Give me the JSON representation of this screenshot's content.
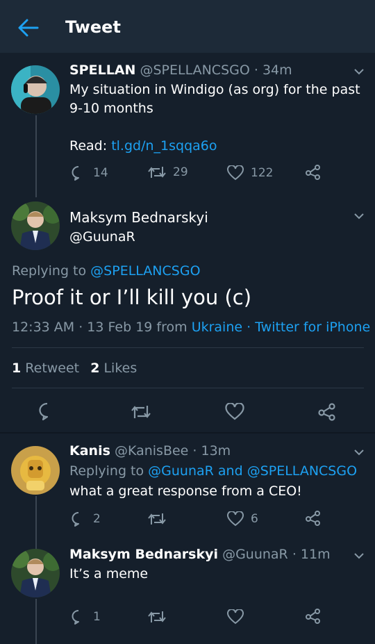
{
  "header": {
    "title": "Tweet"
  },
  "tweet1": {
    "name": "SPELLAN",
    "handle": "@SPELLANCSGO",
    "time": "· 34m",
    "text_line1": "My situation in Windigo (as org) for the past",
    "text_line2": "9-10 months",
    "read_label": "Read:",
    "link": "tl.gd/n_1sqqa6o",
    "replies": "14",
    "retweets": "29",
    "likes": "122"
  },
  "main": {
    "name": "Maksym Bednarskyi",
    "handle": "@GuunaR",
    "replying_label": "Replying to",
    "replying_to": "@SPELLANCSGO",
    "text": "Proof it or I’ll kill you (c)",
    "time": "12:33 AM · 13 Feb 19 from",
    "location": "Ukraine",
    "source": "· Twitter for iPhone",
    "retweet_count": "1",
    "retweet_label": "Retweet",
    "like_count": "2",
    "like_label": "Likes"
  },
  "reply1": {
    "name": "Kanis",
    "handle": "@KanisBee",
    "time": "· 13m",
    "replying_label": "Replying to",
    "replying_to": "@GuunaR and @SPELLANCSGO",
    "text": "what a great response from a CEO!",
    "replies": "2",
    "likes": "6"
  },
  "reply2": {
    "name": "Maksym Bednarskyi",
    "handle": "@GuunaR",
    "time": "· 11m",
    "text": "It’s a meme",
    "replies": "1"
  },
  "colors": {
    "background": "#151f2b",
    "header": "#1d2a38",
    "accent": "#1da1f2",
    "muted": "#8899a6"
  }
}
